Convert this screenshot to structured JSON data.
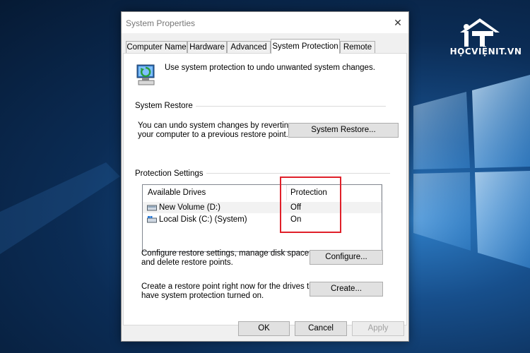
{
  "brand": {
    "text": "HỌCVIỆNIT.VN"
  },
  "dialog": {
    "title": "System Properties",
    "close_label": "✕",
    "tabs": [
      {
        "label": "Computer Name"
      },
      {
        "label": "Hardware"
      },
      {
        "label": "Advanced"
      },
      {
        "label": "System Protection",
        "active": true
      },
      {
        "label": "Remote"
      }
    ],
    "header_text": "Use system protection to undo unwanted system changes.",
    "system_restore": {
      "group_title": "System Restore",
      "desc_line1": "You can undo system changes by reverting",
      "desc_line2": "your computer to a previous restore point.",
      "button_label": "System Restore...",
      "button_mnemonic": "S"
    },
    "protection_settings": {
      "group_title": "Protection Settings",
      "columns": [
        "Available Drives",
        "Protection"
      ],
      "drives": [
        {
          "name": "New Volume (D:)",
          "protection": "Off",
          "selected": true,
          "icon": "drive-icon"
        },
        {
          "name": "Local Disk (C:) (System)",
          "protection": "On",
          "selected": false,
          "icon": "system-drive-icon"
        }
      ],
      "configure_desc_line1": "Configure restore settings, manage disk space,",
      "configure_desc_line2": "and delete restore points.",
      "configure_button": "Configure...",
      "create_desc_line1": "Create a restore point right now for the drives that",
      "create_desc_line2": "have system protection turned on.",
      "create_button": "Create..."
    },
    "footer": {
      "ok": "OK",
      "cancel": "Cancel",
      "apply": "Apply"
    }
  },
  "colors": {
    "highlight_border": "#e0202a",
    "desktop_blue": "#174f8c"
  }
}
